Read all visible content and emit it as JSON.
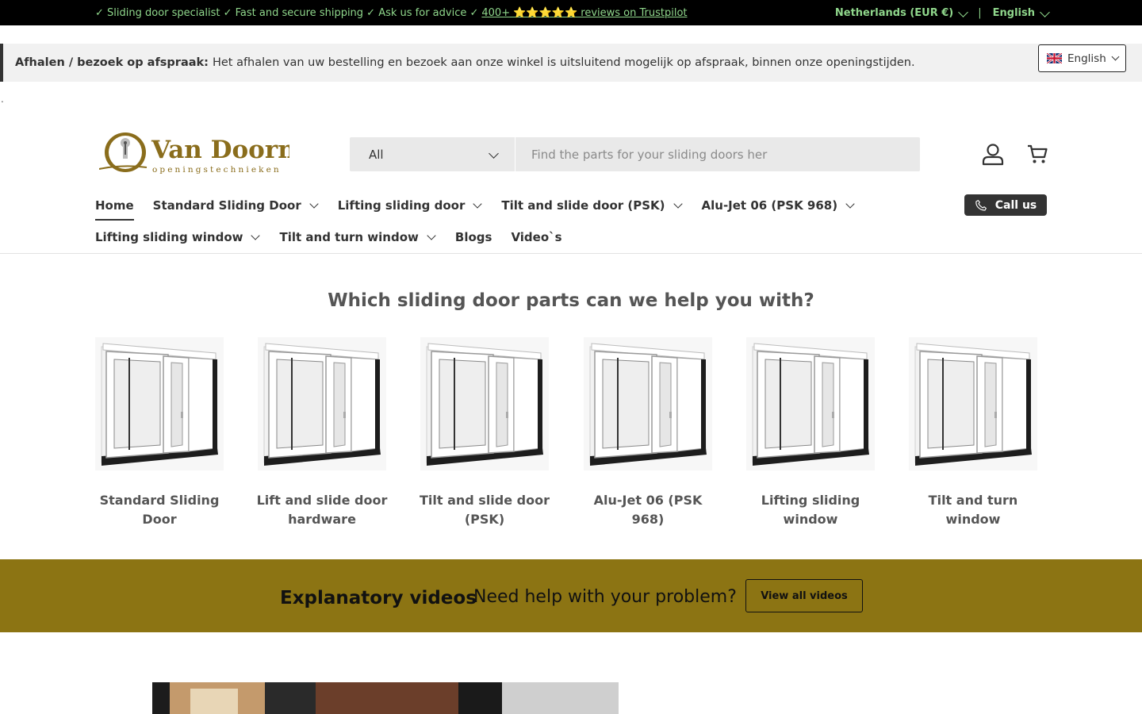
{
  "topbar": {
    "usp_text": "✓ Sliding door specialist ✓ Fast and secure shipping ✓ Ask us for advice ✓",
    "trustpilot_link": "400+ ⭐⭐⭐⭐⭐ reviews on Trustpilot",
    "country": "Netherlands (EUR €)",
    "separator": "|",
    "language": "English"
  },
  "notice": {
    "title": "Afhalen / bezoek op afspraak:",
    "text": "Het afhalen van uw bestelling en bezoek aan onze winkel is uitsluitend mogelijk op afspraak, binnen onze openingstijden."
  },
  "language_switcher": {
    "label": "English"
  },
  "stray_dot": ".",
  "logo": {
    "name": "Van Doorn",
    "tagline": "openingstechnieken"
  },
  "search": {
    "category": "All",
    "placeholder": "Find the parts for your sliding doors her"
  },
  "nav": {
    "row1": [
      {
        "label": "Home",
        "dropdown": false,
        "active": true
      },
      {
        "label": "Standard Sliding Door",
        "dropdown": true
      },
      {
        "label": "Lifting sliding door",
        "dropdown": true
      },
      {
        "label": "Tilt and slide door (PSK)",
        "dropdown": true
      },
      {
        "label": "Alu-Jet 06 (PSK 968)",
        "dropdown": true
      }
    ],
    "row2": [
      {
        "label": "Lifting sliding window",
        "dropdown": true
      },
      {
        "label": "Tilt and turn window",
        "dropdown": true
      },
      {
        "label": "Blogs",
        "dropdown": false
      },
      {
        "label": "Video`s",
        "dropdown": false
      }
    ],
    "call_label": "Call us"
  },
  "categories": {
    "title": "Which sliding door parts can we help you with?",
    "items": [
      {
        "label": "Standard Sliding Door"
      },
      {
        "label": "Lift and slide door hardware"
      },
      {
        "label": "Tilt and slide door (PSK)"
      },
      {
        "label": "Alu-Jet 06 (PSK 968)"
      },
      {
        "label": "Lifting sliding window"
      },
      {
        "label": "Tilt and turn window"
      }
    ]
  },
  "videos": {
    "heading": "Explanatory videos",
    "subtitle": "Need help with your problem?",
    "button": "View all videos"
  },
  "colors": {
    "topbar_bg": "#000000",
    "topbar_text": "#8fd68b",
    "band_bg": "#8c7413",
    "logo_gold": "#8a6d1c"
  }
}
